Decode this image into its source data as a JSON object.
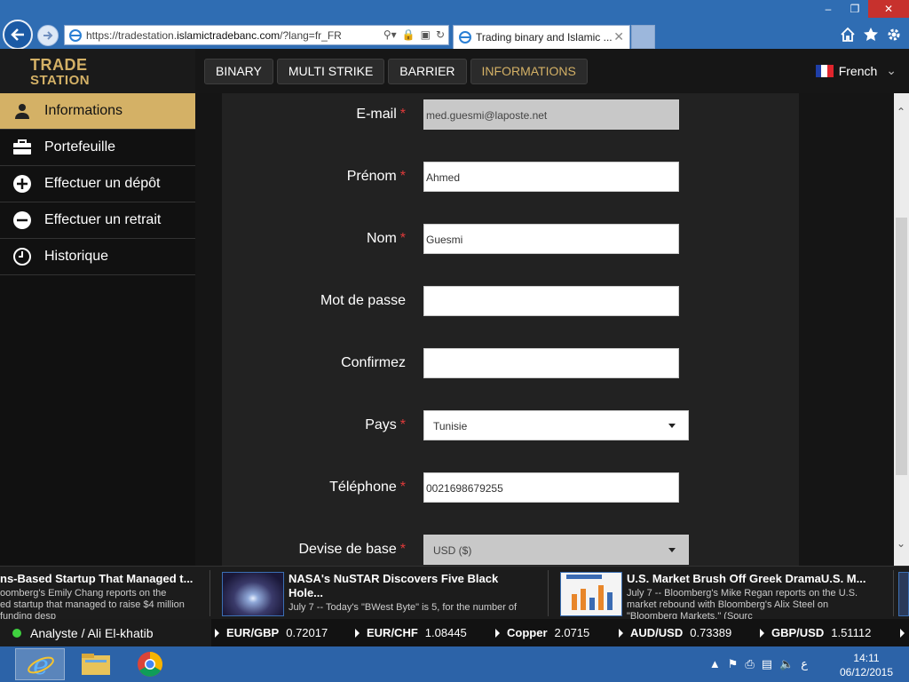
{
  "browser": {
    "url_prefix": "https://tradestation.",
    "url_domain": "islamictradebanc.com",
    "url_suffix": "/?lang=fr_FR",
    "tab_title": "Trading binary and Islamic ..."
  },
  "app": {
    "logo_line1": "TRADE",
    "logo_line2": "STATION",
    "nav": [
      "BINARY",
      "MULTI STRIKE",
      "BARRIER",
      "INFORMATIONS"
    ],
    "language": "French"
  },
  "sidebar": {
    "items": [
      {
        "label": "Informations",
        "icon": "user-icon"
      },
      {
        "label": "Portefeuille",
        "icon": "briefcase-icon"
      },
      {
        "label": "Effectuer un dépôt",
        "icon": "plus-circle-icon"
      },
      {
        "label": "Effectuer un retrait",
        "icon": "minus-circle-icon"
      },
      {
        "label": "Historique",
        "icon": "clock-icon"
      }
    ]
  },
  "form": {
    "fields": [
      {
        "label": "E-mail",
        "required": "*",
        "value": "med.guesmi@laposte.net"
      },
      {
        "label": "Prénom",
        "required": "*",
        "value": "Ahmed"
      },
      {
        "label": "Nom",
        "required": "*",
        "value": "Guesmi"
      },
      {
        "label": "Mot de passe",
        "required": "",
        "value": ""
      },
      {
        "label": "Confirmez",
        "required": "",
        "value": ""
      },
      {
        "label": "Pays",
        "required": "*",
        "value": "Tunisie"
      },
      {
        "label": "Téléphone",
        "required": "*",
        "value": "0021698679255"
      },
      {
        "label": "Devise de base",
        "required": "*",
        "value": "USD  ($)"
      }
    ]
  },
  "news": [
    {
      "title": "ns-Based Startup That Managed t...",
      "line1": "oomberg's Emily Chang reports on the",
      "line2": "ed startup that managed to raise $4 million",
      "line3": "funding desp"
    },
    {
      "title": "NASA's NuSTAR Discovers Five Black",
      "title2": "Hole...",
      "line1": "July 7 -- Today's \"BWest Byte\" is 5, for the number of"
    },
    {
      "title": "U.S. Market Brush Off Greek DramaU.S. M...",
      "line1": "July 7 -- Bloomberg's Mike Regan reports on the U.S.",
      "line2": "market rebound with Bloomberg's Alix Steel on",
      "line3": "\"Bloomberg Markets.\" (Sourc"
    }
  ],
  "ticker": {
    "user": "Analyste / Ali El-khatib",
    "quotes": [
      {
        "sym": "EUR/GBP",
        "val": "0.72017"
      },
      {
        "sym": "EUR/CHF",
        "val": "1.08445"
      },
      {
        "sym": "Copper",
        "val": "2.0715"
      },
      {
        "sym": "AUD/USD",
        "val": "0.73389"
      },
      {
        "sym": "GBP/USD",
        "val": "1.51112"
      }
    ]
  },
  "taskbar": {
    "time": "14:11",
    "date": "06/12/2015",
    "ime": "ع"
  },
  "colors": {
    "accent_gold": "#d4b166",
    "required_red": "#e03a3a",
    "online_green": "#3fd13f"
  }
}
